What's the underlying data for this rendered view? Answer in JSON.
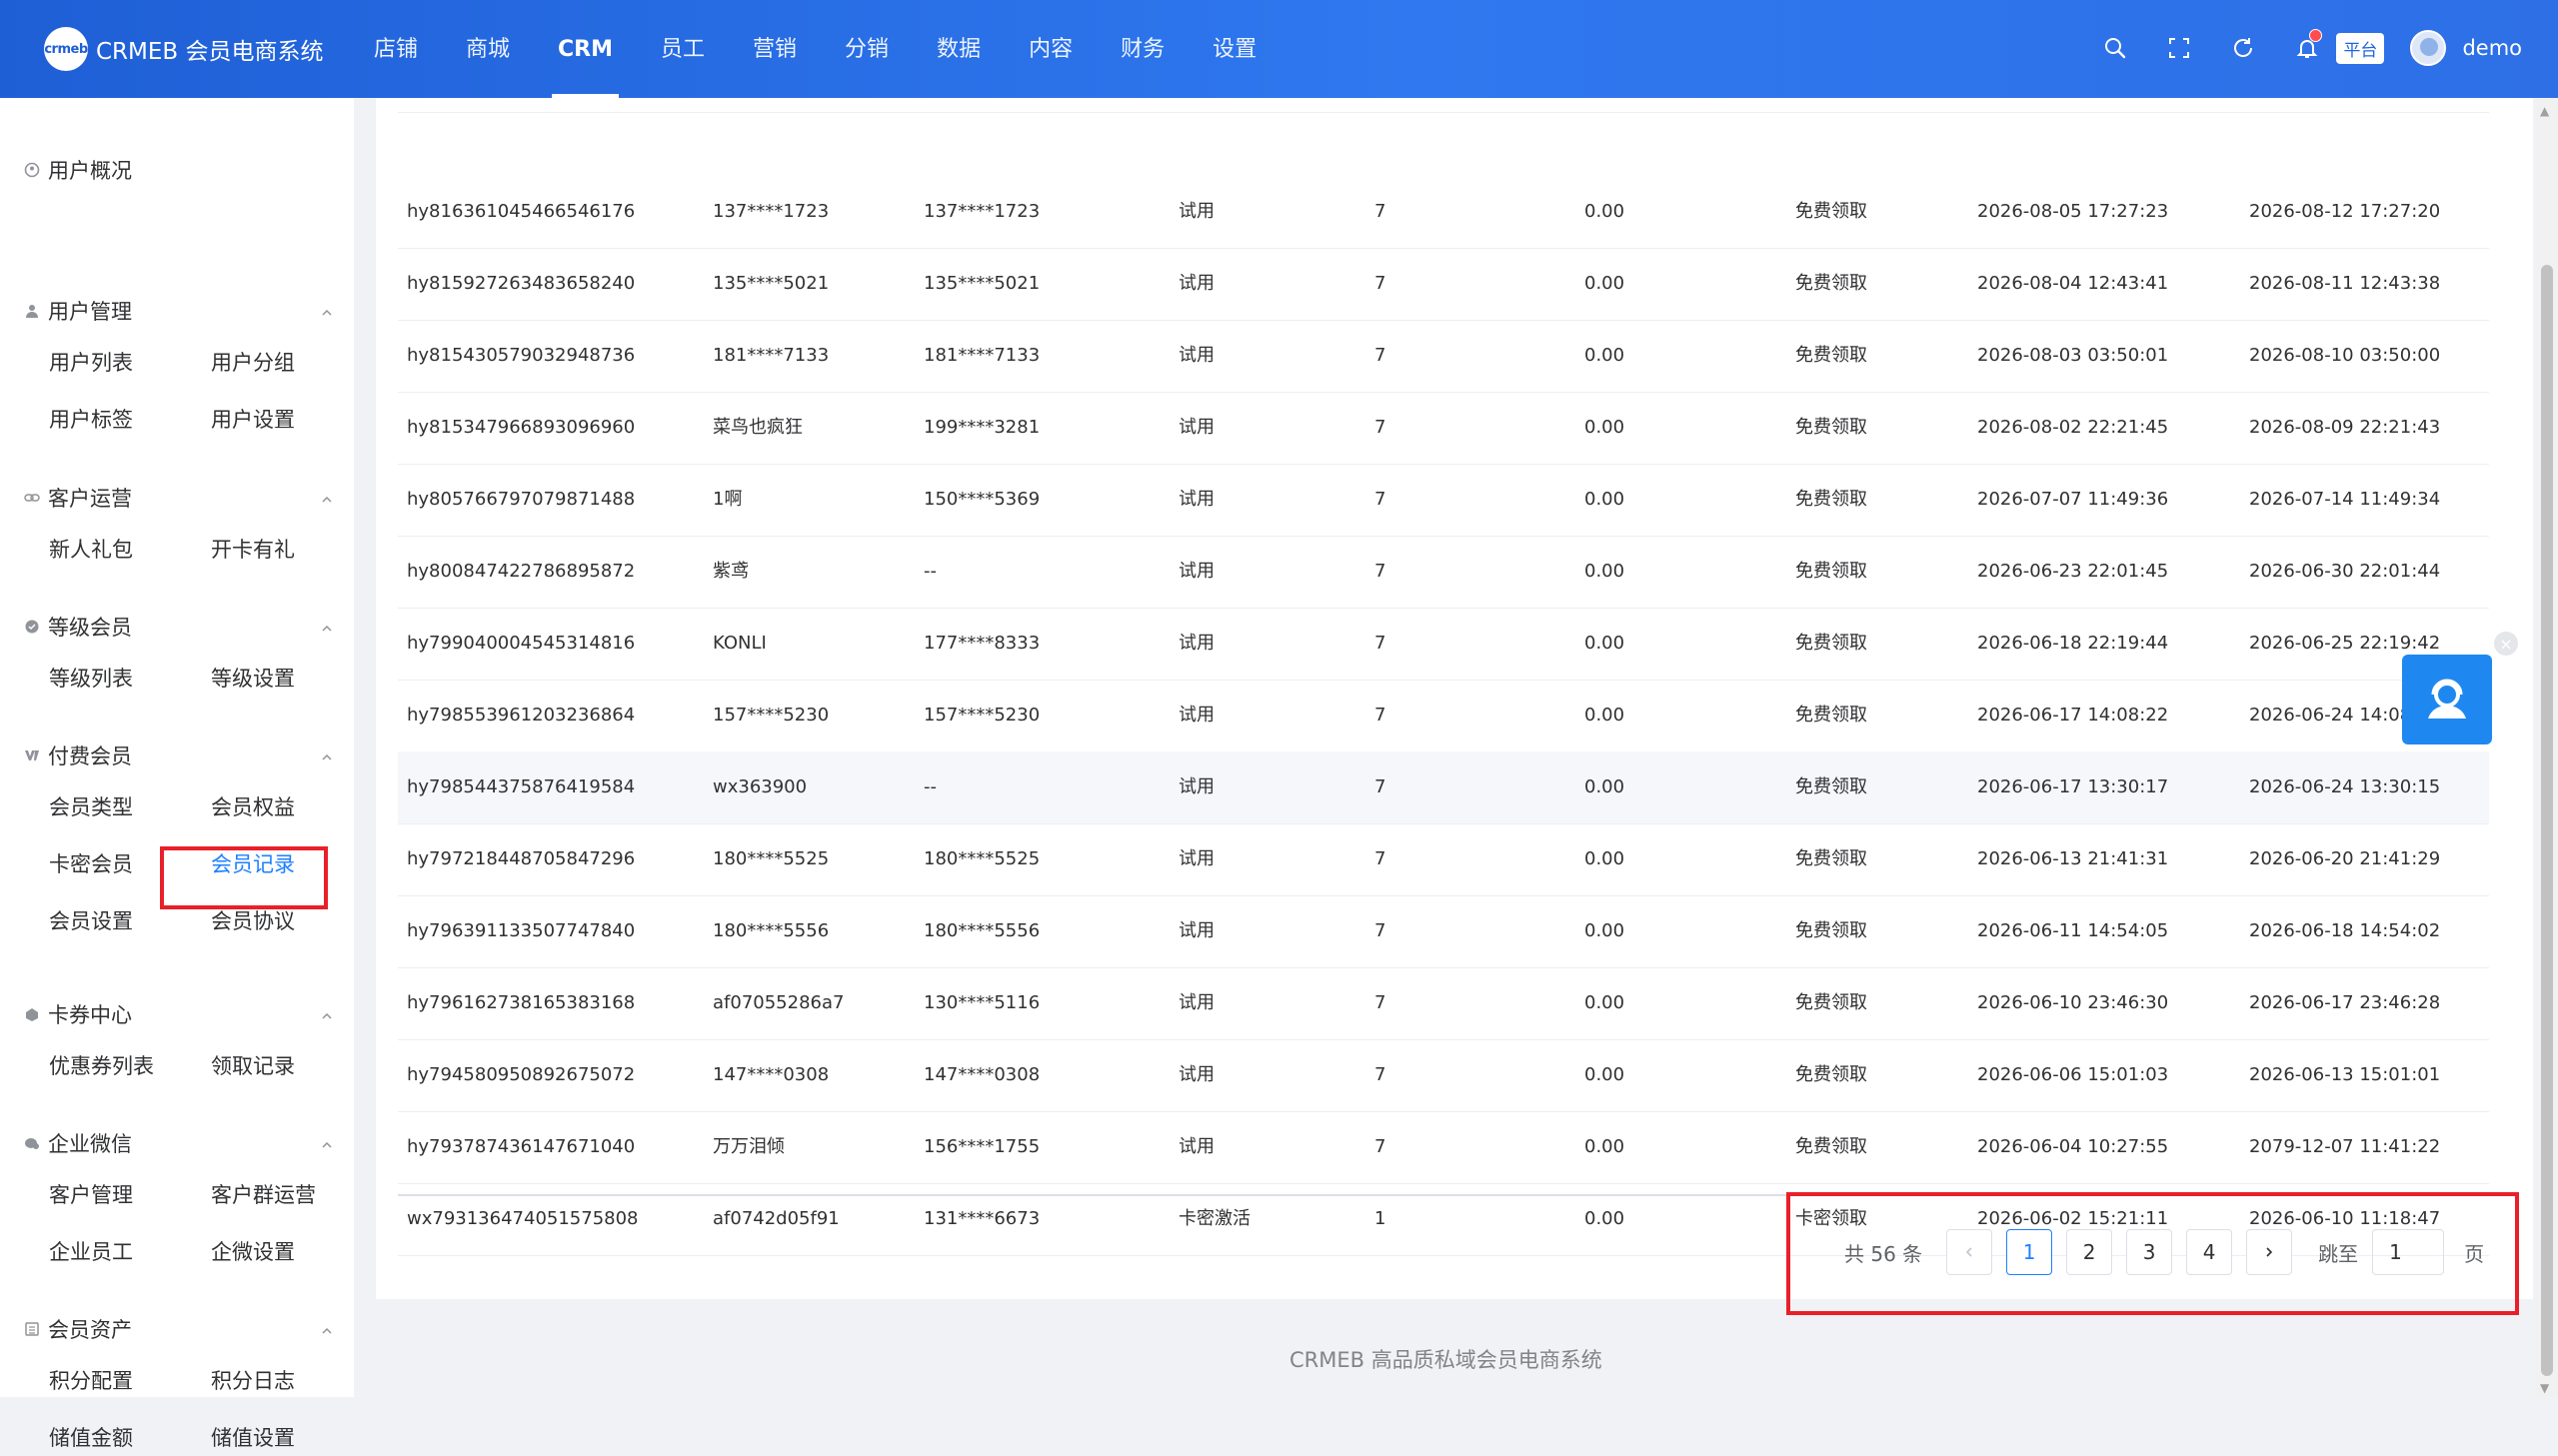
{
  "header": {
    "logo_mark": "crmeb",
    "logo_text": "CRMEB 会员电商系统",
    "nav": [
      "店铺",
      "商城",
      "CRM",
      "员工",
      "营销",
      "分销",
      "数据",
      "内容",
      "财务",
      "设置"
    ],
    "nav_active": "CRM",
    "platform_badge": "平台",
    "user_name": "demo"
  },
  "sidebar": {
    "overview": "用户概况",
    "groups": [
      {
        "title": "用户管理",
        "icon": "user-icon",
        "items": [
          "用户列表",
          "用户分组",
          "用户标签",
          "用户设置"
        ]
      },
      {
        "title": "客户运营",
        "icon": "link-icon",
        "items": [
          "新人礼包",
          "开卡有礼"
        ]
      },
      {
        "title": "等级会员",
        "icon": "level-icon",
        "items": [
          "等级列表",
          "等级设置"
        ]
      },
      {
        "title": "付费会员",
        "icon": "vip-icon",
        "items": [
          "会员类型",
          "会员权益",
          "卡密会员",
          "会员记录",
          "会员设置",
          "会员协议"
        ]
      },
      {
        "title": "卡券中心",
        "icon": "coupon-icon",
        "items": [
          "优惠券列表",
          "领取记录"
        ]
      },
      {
        "title": "企业微信",
        "icon": "wechat-work-icon",
        "items": [
          "客户管理",
          "客户群运营",
          "企业员工",
          "企微设置"
        ]
      },
      {
        "title": "会员资产",
        "icon": "asset-icon",
        "items": [
          "积分配置",
          "积分日志",
          "储值金额",
          "储值设置"
        ]
      }
    ],
    "active_item": "会员记录"
  },
  "table": {
    "rows": [
      [
        "hy816361045466546176",
        "137****1723",
        "137****1723",
        "试用",
        "7",
        "0.00",
        "免费领取",
        "2026-08-05 17:27:23",
        "2026-08-12 17:27:20"
      ],
      [
        "hy815927263483658240",
        "135****5021",
        "135****5021",
        "试用",
        "7",
        "0.00",
        "免费领取",
        "2026-08-04 12:43:41",
        "2026-08-11 12:43:38"
      ],
      [
        "hy815430579032948736",
        "181****7133",
        "181****7133",
        "试用",
        "7",
        "0.00",
        "免费领取",
        "2026-08-03 03:50:01",
        "2026-08-10 03:50:00"
      ],
      [
        "hy815347966893096960",
        "菜鸟也疯狂",
        "199****3281",
        "试用",
        "7",
        "0.00",
        "免费领取",
        "2026-08-02 22:21:45",
        "2026-08-09 22:21:43"
      ],
      [
        "hy805766797079871488",
        "1啊",
        "150****5369",
        "试用",
        "7",
        "0.00",
        "免费领取",
        "2026-07-07 11:49:36",
        "2026-07-14 11:49:34"
      ],
      [
        "hy800847422786895872",
        "紫鸢",
        "--",
        "试用",
        "7",
        "0.00",
        "免费领取",
        "2026-06-23 22:01:45",
        "2026-06-30 22:01:44"
      ],
      [
        "hy799040004545314816",
        "KONLI",
        "177****8333",
        "试用",
        "7",
        "0.00",
        "免费领取",
        "2026-06-18 22:19:44",
        "2026-06-25 22:19:42"
      ],
      [
        "hy798553961203236864",
        "157****5230",
        "157****5230",
        "试用",
        "7",
        "0.00",
        "免费领取",
        "2026-06-17 14:08:22",
        "2026-06-24 14:08:20"
      ],
      [
        "hy798544375876419584",
        "wx363900",
        "--",
        "试用",
        "7",
        "0.00",
        "免费领取",
        "2026-06-17 13:30:17",
        "2026-06-24 13:30:15"
      ],
      [
        "hy797218448705847296",
        "180****5525",
        "180****5525",
        "试用",
        "7",
        "0.00",
        "免费领取",
        "2026-06-13 21:41:31",
        "2026-06-20 21:41:29"
      ],
      [
        "hy796391133507747840",
        "180****5556",
        "180****5556",
        "试用",
        "7",
        "0.00",
        "免费领取",
        "2026-06-11 14:54:05",
        "2026-06-18 14:54:02"
      ],
      [
        "hy796162738165383168",
        "af07055286a7",
        "130****5116",
        "试用",
        "7",
        "0.00",
        "免费领取",
        "2026-06-10 23:46:30",
        "2026-06-17 23:46:28"
      ],
      [
        "hy794580950892675072",
        "147****0308",
        "147****0308",
        "试用",
        "7",
        "0.00",
        "免费领取",
        "2026-06-06 15:01:03",
        "2026-06-13 15:01:01"
      ],
      [
        "hy793787436147671040",
        "万万泪倾",
        "156****1755",
        "试用",
        "7",
        "0.00",
        "免费领取",
        "2026-06-04 10:27:55",
        "2079-12-07 11:41:22"
      ],
      [
        "wx793136474051575808",
        "af0742d05f91",
        "131****6673",
        "卡密激活",
        "1",
        "0.00",
        "卡密领取",
        "2026-06-02 15:21:11",
        "2026-06-10 11:18:47"
      ]
    ],
    "hover_row": 8
  },
  "pagination": {
    "total": "共 56 条",
    "pages": [
      "1",
      "2",
      "3",
      "4"
    ],
    "current": "1",
    "jump_label": "跳至",
    "jump_value": "1",
    "page_suffix": "页"
  },
  "footer": "CRMEB 高品质私域会员电商系统",
  "colors": {
    "header_blue": "#2f78ef",
    "accent": "#1e80ff",
    "highlight_red": "#e8202a"
  }
}
